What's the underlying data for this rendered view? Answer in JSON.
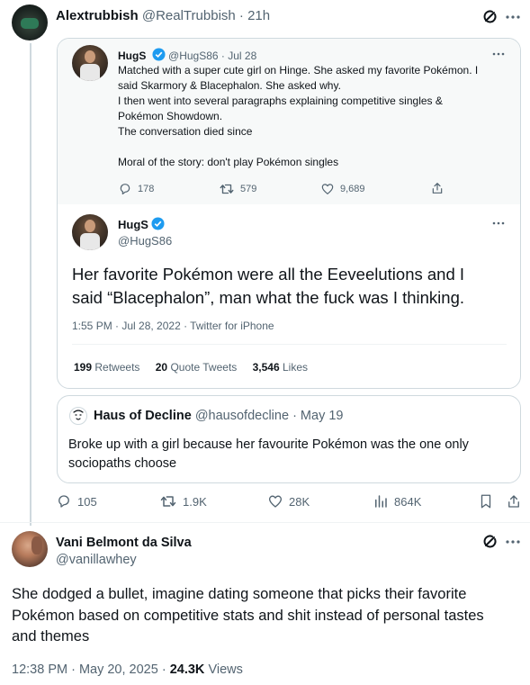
{
  "reply_tweet": {
    "author_name": "Alextrubbish",
    "author_handle": "@RealTrubbish",
    "time": "· 21h",
    "stats": {
      "replies": "105",
      "retweets": "1.9K",
      "likes": "28K",
      "views": "864K"
    }
  },
  "quoted_first": {
    "author_name": "HugS",
    "author_handle": "@HugS86",
    "date": "· Jul 28",
    "text_lines": [
      "Matched with a super cute girl on Hinge. She asked my favorite Pokémon. I",
      "said Skarmory & Blacephalon. She asked why.",
      "I then went into several paragraphs explaining competitive singles &",
      "Pokémon Showdown.",
      "The conversation died since",
      "Moral of the story: don't play Pokémon singles"
    ],
    "stats": {
      "replies": "178",
      "retweets": "579",
      "likes": "9,689"
    }
  },
  "quoted_main": {
    "author_name": "HugS",
    "author_handle": "@HugS86",
    "text_line1": "Her favorite Pokémon were all the Eeveelutions and I",
    "text_line2": "said “Blacephalon”, man what the fuck was I thinking.",
    "meta": "1:55 PM · Jul 28, 2022 · Twitter for iPhone",
    "retweets_count": "199",
    "retweets_label": "Retweets",
    "quotes_count": "20",
    "quotes_label": "Quote Tweets",
    "likes_count": "3,546",
    "likes_label": "Likes"
  },
  "quoted_second": {
    "author_name": "Haus of Decline",
    "author_handle": "@hausofdecline",
    "date": "· May 19",
    "text_line1": "Broke up with a girl because her favourite Pokémon was the one only",
    "text_line2": "sociopaths choose"
  },
  "bottom_tweet": {
    "author_name": "Vani Belmont da Silva",
    "author_handle": "@vanillawhey",
    "text_line1": "She dodged a bullet, imagine dating someone that picks their favorite",
    "text_line2": "Pokémon based on competitive stats and shit instead of personal tastes",
    "text_line3": "and themes",
    "time": "12:38 PM · May 20, 2025 ·",
    "views_count": "24.3K",
    "views_label": "Views"
  },
  "colors": {
    "accent": "#1d9bf0",
    "muted": "#536471",
    "border": "#cfd9de"
  },
  "icons": [
    "grok-icon",
    "more-icon",
    "reply-icon",
    "retweet-icon",
    "like-icon",
    "views-icon",
    "bookmark-icon",
    "share-icon",
    "verified-icon"
  ]
}
